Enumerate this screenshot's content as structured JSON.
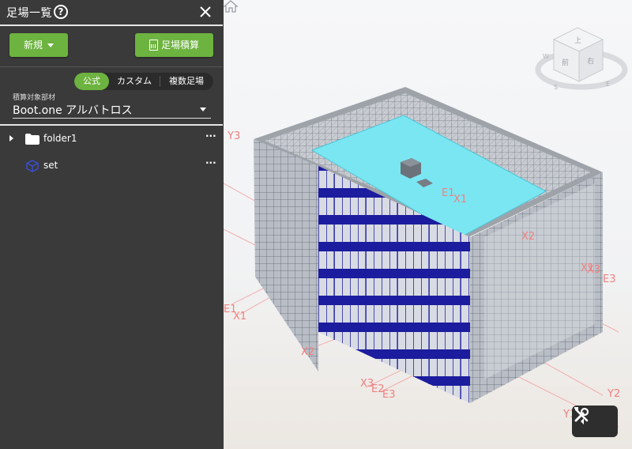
{
  "panel": {
    "title": "足場一覧",
    "help_icon": "?",
    "new_button": "新規",
    "calc_button": "足場積算",
    "tabs": [
      {
        "label": "公式",
        "active": true
      },
      {
        "label": "カスタム",
        "active": false
      },
      {
        "label": "複数足場",
        "active": false
      }
    ],
    "target_label": "積算対象部材",
    "target_value": "Boot.one アルバトロス",
    "tree": [
      {
        "label": "folder1",
        "icon": "folder-icon",
        "more": "···"
      },
      {
        "label": "set",
        "icon": "cube-icon",
        "more": "···"
      }
    ]
  },
  "viewcube": {
    "top": "上",
    "front": "前",
    "right": "右",
    "compass": [
      "S",
      "E",
      "W"
    ]
  },
  "grid_labels": [
    "Y3",
    "E1",
    "X1",
    "X2",
    "X1",
    "E1",
    "X1",
    "X2",
    "X3",
    "E2",
    "E3",
    "X3",
    "E3",
    "Y2",
    "Y1"
  ],
  "colors": {
    "accent": "#6db33f",
    "panel_bg": "#3a3a3a",
    "axis": "#f08080",
    "selected": "#1a1a9c",
    "roof": "#7ae6f2"
  }
}
